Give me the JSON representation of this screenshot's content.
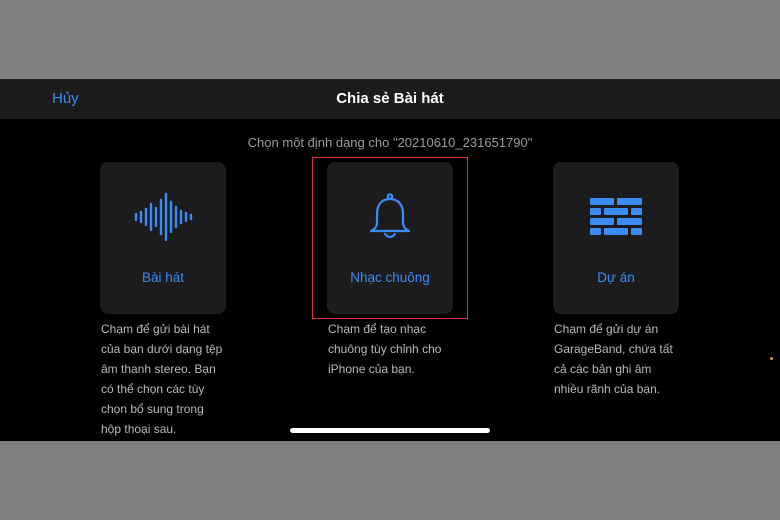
{
  "navbar": {
    "cancel_label": "Hủy",
    "title": "Chia sẻ Bài hát"
  },
  "subtitle": "Chọn một định dạng cho \"20210610_231651790\"",
  "options": [
    {
      "label": "Bài hát",
      "icon": "waveform-icon",
      "description_lines": [
        "Chạm để gửi bài hát",
        "của bạn dưới dạng tệp",
        "âm thanh stereo. Bạn",
        "có thể chọn các tùy",
        "chọn bổ sung trong",
        "hộp thoại sau."
      ]
    },
    {
      "label": "Nhạc chuông",
      "icon": "bell-icon",
      "highlighted": true,
      "description_lines": [
        "Chạm để tạo nhạc",
        "chuông tùy chỉnh cho",
        "iPhone của bạn."
      ]
    },
    {
      "label": "Dự án",
      "icon": "brick-wall-icon",
      "description_lines": [
        "Chạm để gửi dự án",
        "GarageBand, chứa tất",
        "cả các bản ghi âm",
        "nhiều rãnh của bạn."
      ]
    }
  ],
  "colors": {
    "accent": "#3b8cf5",
    "highlight_border": "#e0312b",
    "card_bg": "#1c1c1e",
    "screen_bg": "#000000"
  }
}
